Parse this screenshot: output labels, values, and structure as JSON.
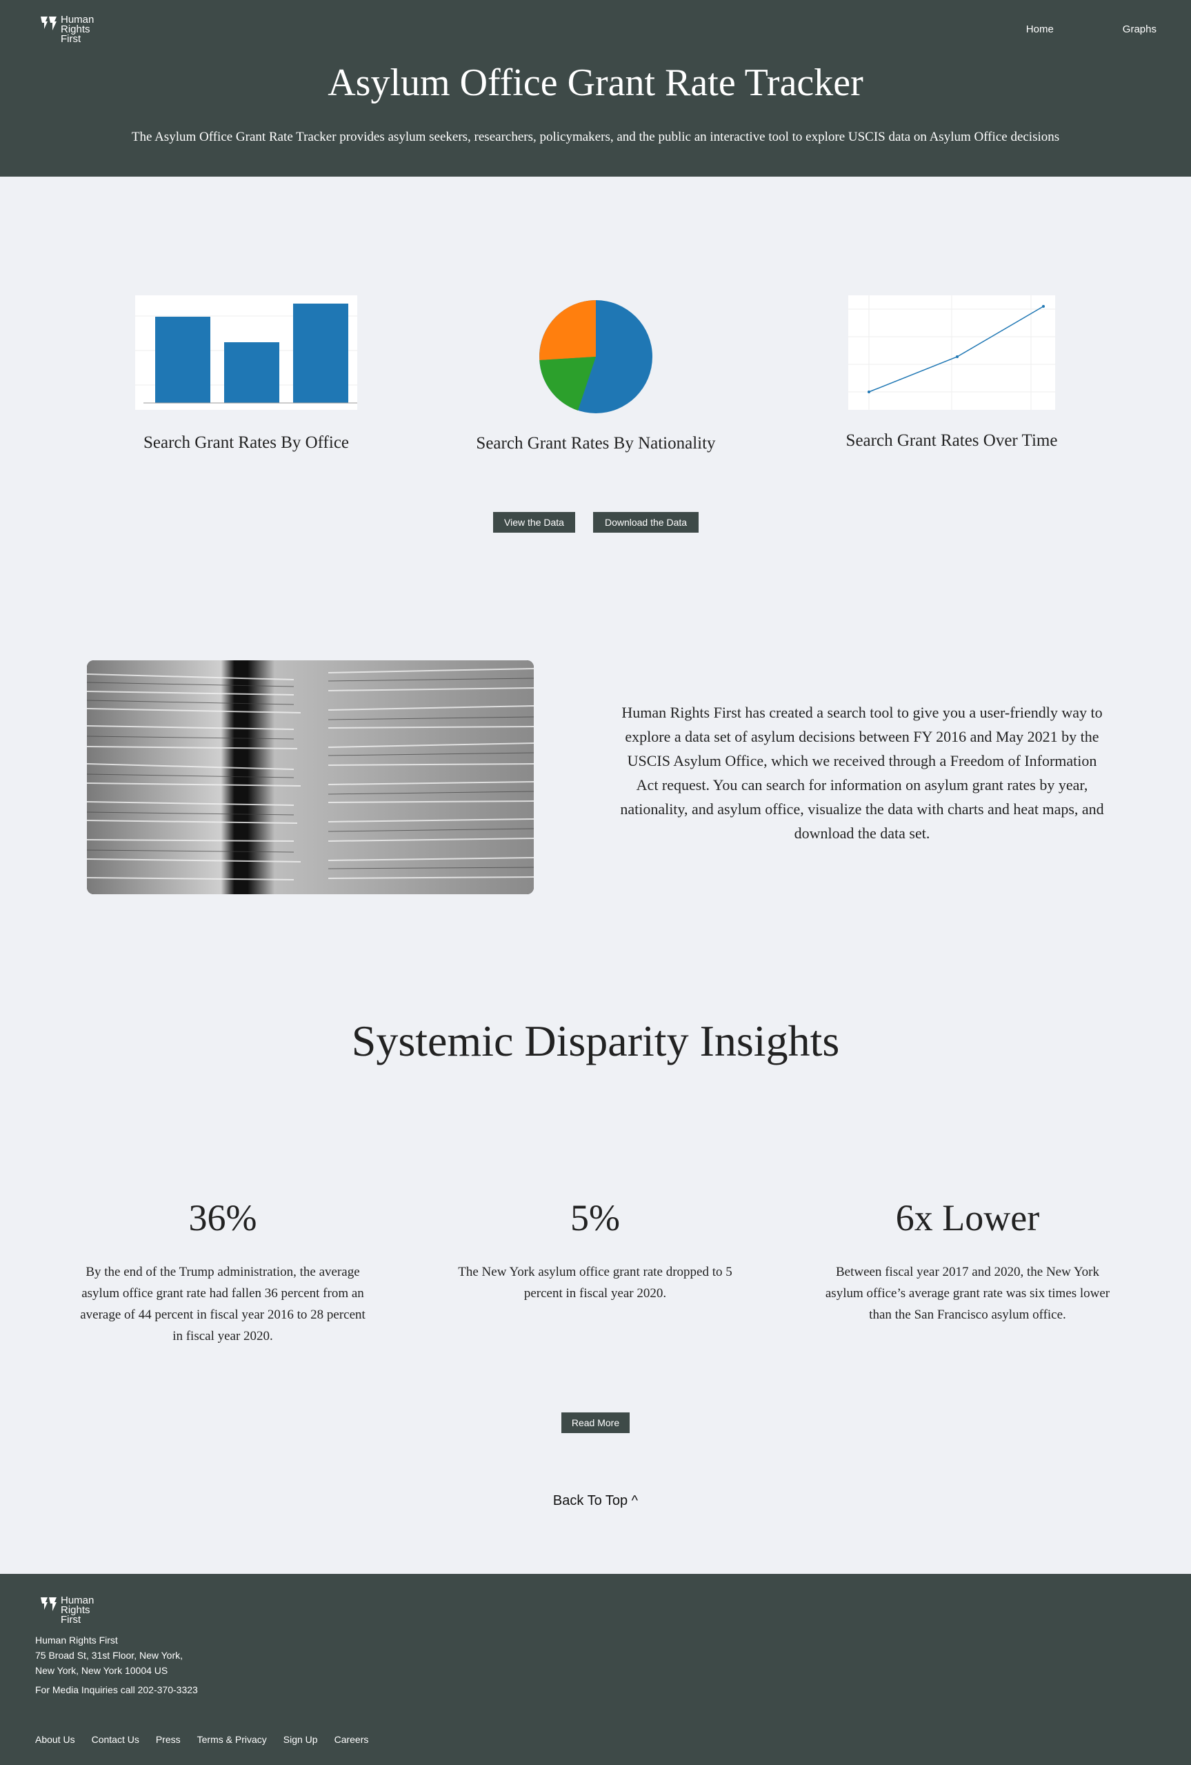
{
  "brand": {
    "logo_lines": [
      "Human",
      "Rights",
      "First"
    ],
    "primary_color": "#3e4a48",
    "background_color": "#eff1f5"
  },
  "nav": {
    "home": "Home",
    "graphs": "Graphs"
  },
  "hero": {
    "title": "Asylum Office Grant Rate Tracker",
    "subtitle": "The Asylum Office Grant Rate Tracker provides asylum seekers, researchers, policymakers, and the public an interactive tool to explore USCIS data on Asylum Office decisions"
  },
  "features": [
    {
      "label": "Search Grant Rates By Office",
      "icon": "bar-chart-thumbnail"
    },
    {
      "label": "Search Grant Rates By Nationality",
      "icon": "pie-chart-thumbnail"
    },
    {
      "label": "Search Grant Rates Over Time",
      "icon": "line-chart-thumbnail"
    }
  ],
  "buttons": {
    "view_data": "View the Data",
    "download_data": "Download the Data",
    "read_more": "Read More"
  },
  "intro": {
    "image_icon": "stacked-files-photo",
    "text": "Human Rights First has created a search tool to give you a user-friendly way to explore a data set of asylum decisions between FY 2016 and May 2021 by the USCIS Asylum Office, which we received through a Freedom of Information Act request. You can search for information on asylum grant rates by year, nationality, and asylum office, visualize the data with charts and heat maps, and download the data set."
  },
  "insights": {
    "title": "Systemic Disparity Insights",
    "stats": [
      {
        "value": "36%",
        "text": "By the end of the Trump administration, the average asylum office grant rate had fallen 36 percent from an average of 44 percent in fiscal year 2016 to 28 percent in fiscal year 2020."
      },
      {
        "value": "5%",
        "text": "The New York asylum office grant rate dropped to 5 percent in fiscal year 2020."
      },
      {
        "value": "6x Lower",
        "text": "Between fiscal year 2017 and 2020, the New York asylum office’s average grant rate was six times lower than the San Francisco asylum office."
      }
    ]
  },
  "back_to_top": "Back To Top ^",
  "footer": {
    "org": "Human Rights First",
    "address_1": "75 Broad St, 31st Floor, New York,",
    "address_2": "New York, New York 10004 US",
    "media": "For Media Inquiries call 202-370-3323",
    "links": [
      "About Us",
      "Contact Us",
      "Press",
      "Terms & Privacy",
      "Sign Up",
      "Careers"
    ]
  }
}
